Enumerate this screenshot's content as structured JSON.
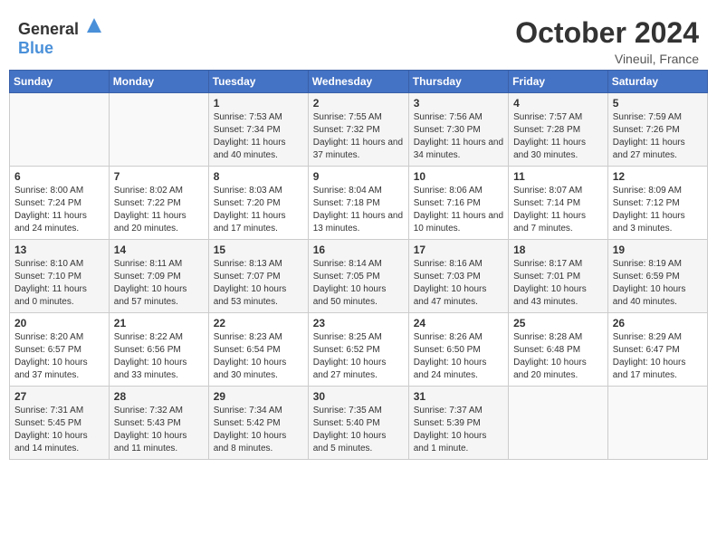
{
  "header": {
    "logo_general": "General",
    "logo_blue": "Blue",
    "month": "October 2024",
    "location": "Vineuil, France"
  },
  "calendar": {
    "weekdays": [
      "Sunday",
      "Monday",
      "Tuesday",
      "Wednesday",
      "Thursday",
      "Friday",
      "Saturday"
    ],
    "weeks": [
      [
        {
          "day": "",
          "info": ""
        },
        {
          "day": "",
          "info": ""
        },
        {
          "day": "1",
          "info": "Sunrise: 7:53 AM\nSunset: 7:34 PM\nDaylight: 11 hours and 40 minutes."
        },
        {
          "day": "2",
          "info": "Sunrise: 7:55 AM\nSunset: 7:32 PM\nDaylight: 11 hours and 37 minutes."
        },
        {
          "day": "3",
          "info": "Sunrise: 7:56 AM\nSunset: 7:30 PM\nDaylight: 11 hours and 34 minutes."
        },
        {
          "day": "4",
          "info": "Sunrise: 7:57 AM\nSunset: 7:28 PM\nDaylight: 11 hours and 30 minutes."
        },
        {
          "day": "5",
          "info": "Sunrise: 7:59 AM\nSunset: 7:26 PM\nDaylight: 11 hours and 27 minutes."
        }
      ],
      [
        {
          "day": "6",
          "info": "Sunrise: 8:00 AM\nSunset: 7:24 PM\nDaylight: 11 hours and 24 minutes."
        },
        {
          "day": "7",
          "info": "Sunrise: 8:02 AM\nSunset: 7:22 PM\nDaylight: 11 hours and 20 minutes."
        },
        {
          "day": "8",
          "info": "Sunrise: 8:03 AM\nSunset: 7:20 PM\nDaylight: 11 hours and 17 minutes."
        },
        {
          "day": "9",
          "info": "Sunrise: 8:04 AM\nSunset: 7:18 PM\nDaylight: 11 hours and 13 minutes."
        },
        {
          "day": "10",
          "info": "Sunrise: 8:06 AM\nSunset: 7:16 PM\nDaylight: 11 hours and 10 minutes."
        },
        {
          "day": "11",
          "info": "Sunrise: 8:07 AM\nSunset: 7:14 PM\nDaylight: 11 hours and 7 minutes."
        },
        {
          "day": "12",
          "info": "Sunrise: 8:09 AM\nSunset: 7:12 PM\nDaylight: 11 hours and 3 minutes."
        }
      ],
      [
        {
          "day": "13",
          "info": "Sunrise: 8:10 AM\nSunset: 7:10 PM\nDaylight: 11 hours and 0 minutes."
        },
        {
          "day": "14",
          "info": "Sunrise: 8:11 AM\nSunset: 7:09 PM\nDaylight: 10 hours and 57 minutes."
        },
        {
          "day": "15",
          "info": "Sunrise: 8:13 AM\nSunset: 7:07 PM\nDaylight: 10 hours and 53 minutes."
        },
        {
          "day": "16",
          "info": "Sunrise: 8:14 AM\nSunset: 7:05 PM\nDaylight: 10 hours and 50 minutes."
        },
        {
          "day": "17",
          "info": "Sunrise: 8:16 AM\nSunset: 7:03 PM\nDaylight: 10 hours and 47 minutes."
        },
        {
          "day": "18",
          "info": "Sunrise: 8:17 AM\nSunset: 7:01 PM\nDaylight: 10 hours and 43 minutes."
        },
        {
          "day": "19",
          "info": "Sunrise: 8:19 AM\nSunset: 6:59 PM\nDaylight: 10 hours and 40 minutes."
        }
      ],
      [
        {
          "day": "20",
          "info": "Sunrise: 8:20 AM\nSunset: 6:57 PM\nDaylight: 10 hours and 37 minutes."
        },
        {
          "day": "21",
          "info": "Sunrise: 8:22 AM\nSunset: 6:56 PM\nDaylight: 10 hours and 33 minutes."
        },
        {
          "day": "22",
          "info": "Sunrise: 8:23 AM\nSunset: 6:54 PM\nDaylight: 10 hours and 30 minutes."
        },
        {
          "day": "23",
          "info": "Sunrise: 8:25 AM\nSunset: 6:52 PM\nDaylight: 10 hours and 27 minutes."
        },
        {
          "day": "24",
          "info": "Sunrise: 8:26 AM\nSunset: 6:50 PM\nDaylight: 10 hours and 24 minutes."
        },
        {
          "day": "25",
          "info": "Sunrise: 8:28 AM\nSunset: 6:48 PM\nDaylight: 10 hours and 20 minutes."
        },
        {
          "day": "26",
          "info": "Sunrise: 8:29 AM\nSunset: 6:47 PM\nDaylight: 10 hours and 17 minutes."
        }
      ],
      [
        {
          "day": "27",
          "info": "Sunrise: 7:31 AM\nSunset: 5:45 PM\nDaylight: 10 hours and 14 minutes."
        },
        {
          "day": "28",
          "info": "Sunrise: 7:32 AM\nSunset: 5:43 PM\nDaylight: 10 hours and 11 minutes."
        },
        {
          "day": "29",
          "info": "Sunrise: 7:34 AM\nSunset: 5:42 PM\nDaylight: 10 hours and 8 minutes."
        },
        {
          "day": "30",
          "info": "Sunrise: 7:35 AM\nSunset: 5:40 PM\nDaylight: 10 hours and 5 minutes."
        },
        {
          "day": "31",
          "info": "Sunrise: 7:37 AM\nSunset: 5:39 PM\nDaylight: 10 hours and 1 minute."
        },
        {
          "day": "",
          "info": ""
        },
        {
          "day": "",
          "info": ""
        }
      ]
    ]
  }
}
